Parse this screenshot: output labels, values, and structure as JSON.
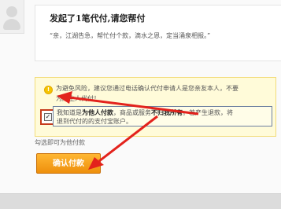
{
  "message": {
    "title": "发起了1笔代付,请您帮付",
    "text": "“亲，江湖告急，帮忙付个款，滴水之恩，定当涌泉相报。”"
  },
  "warning": {
    "line1": "为避免风险，建议您通过电话确认代付申请人是您亲友本人，不要",
    "line2": "为陌生人代付！"
  },
  "agreement": {
    "line1_prefix": "我知道是",
    "line1_bold1": "为他人付款",
    "line1_mid": "，商品或服务",
    "line1_bold2": "不归我所有",
    "line1_suffix": "。若产生退款，将",
    "line2": "退到代付的的支付宝账户。",
    "checked_symbol": "✓"
  },
  "sub_link": "勾选即可为他付款",
  "confirm_button": "确认付款",
  "colors": {
    "arrow": "#e3221c",
    "warn_bg": "#fffbd9",
    "button": "#f5a623"
  }
}
